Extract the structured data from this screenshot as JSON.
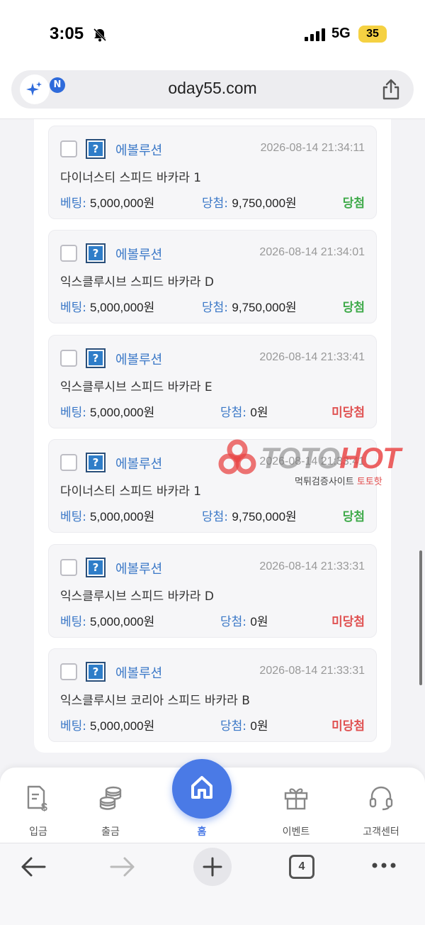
{
  "status_bar": {
    "time": "3:05",
    "network": "5G",
    "battery": "35"
  },
  "browser": {
    "url": "oday55.com",
    "ai_badge": "N",
    "open_tabs": "4"
  },
  "bets": [
    {
      "provider": "에볼루션",
      "time": "2026-08-14 21:34:11",
      "game": "다이너스티 스피드 바카라 1",
      "bet_label": "베팅:",
      "bet_amount": "5,000,000원",
      "win_label": "당첨:",
      "win_amount": "9,750,000원",
      "result": "당첨",
      "status": "win"
    },
    {
      "provider": "에볼루션",
      "time": "2026-08-14 21:34:01",
      "game": "익스클루시브 스피드 바카라 D",
      "bet_label": "베팅:",
      "bet_amount": "5,000,000원",
      "win_label": "당첨:",
      "win_amount": "9,750,000원",
      "result": "당첨",
      "status": "win"
    },
    {
      "provider": "에볼루션",
      "time": "2026-08-14 21:33:41",
      "game": "익스클루시브 스피드 바카라 E",
      "bet_label": "베팅:",
      "bet_amount": "5,000,000원",
      "win_label": "당첨:",
      "win_amount": "0원",
      "result": "미당첨",
      "status": "lose"
    },
    {
      "provider": "에볼루션",
      "time": "2026-08-14 21:33:41",
      "game": "다이너스티 스피드 바카라 1",
      "bet_label": "베팅:",
      "bet_amount": "5,000,000원",
      "win_label": "당첨:",
      "win_amount": "9,750,000원",
      "result": "당첨",
      "status": "win"
    },
    {
      "provider": "에볼루션",
      "time": "2026-08-14 21:33:31",
      "game": "익스클루시브 스피드 바카라 D",
      "bet_label": "베팅:",
      "bet_amount": "5,000,000원",
      "win_label": "당첨:",
      "win_amount": "0원",
      "result": "미당첨",
      "status": "lose"
    },
    {
      "provider": "에볼루션",
      "time": "2026-08-14 21:33:31",
      "game": "익스클루시브 코리아 스피드 바카라 B",
      "bet_label": "베팅:",
      "bet_amount": "5,000,000원",
      "win_label": "당첨:",
      "win_amount": "0원",
      "result": "미당첨",
      "status": "lose"
    }
  ],
  "watermark": {
    "brand_a": "TOTO",
    "brand_b": "HOT",
    "subtitle": "먹튀검증사이트",
    "subtitle_accent": "토토핫"
  },
  "bottom_nav": {
    "deposit": "입금",
    "withdraw": "출금",
    "home": "홈",
    "event": "이벤트",
    "support": "고객센터"
  },
  "colors": {
    "accent": "#4a7ae6",
    "link": "#3b78c7",
    "win": "#3faa4a",
    "lose": "#e05252"
  }
}
